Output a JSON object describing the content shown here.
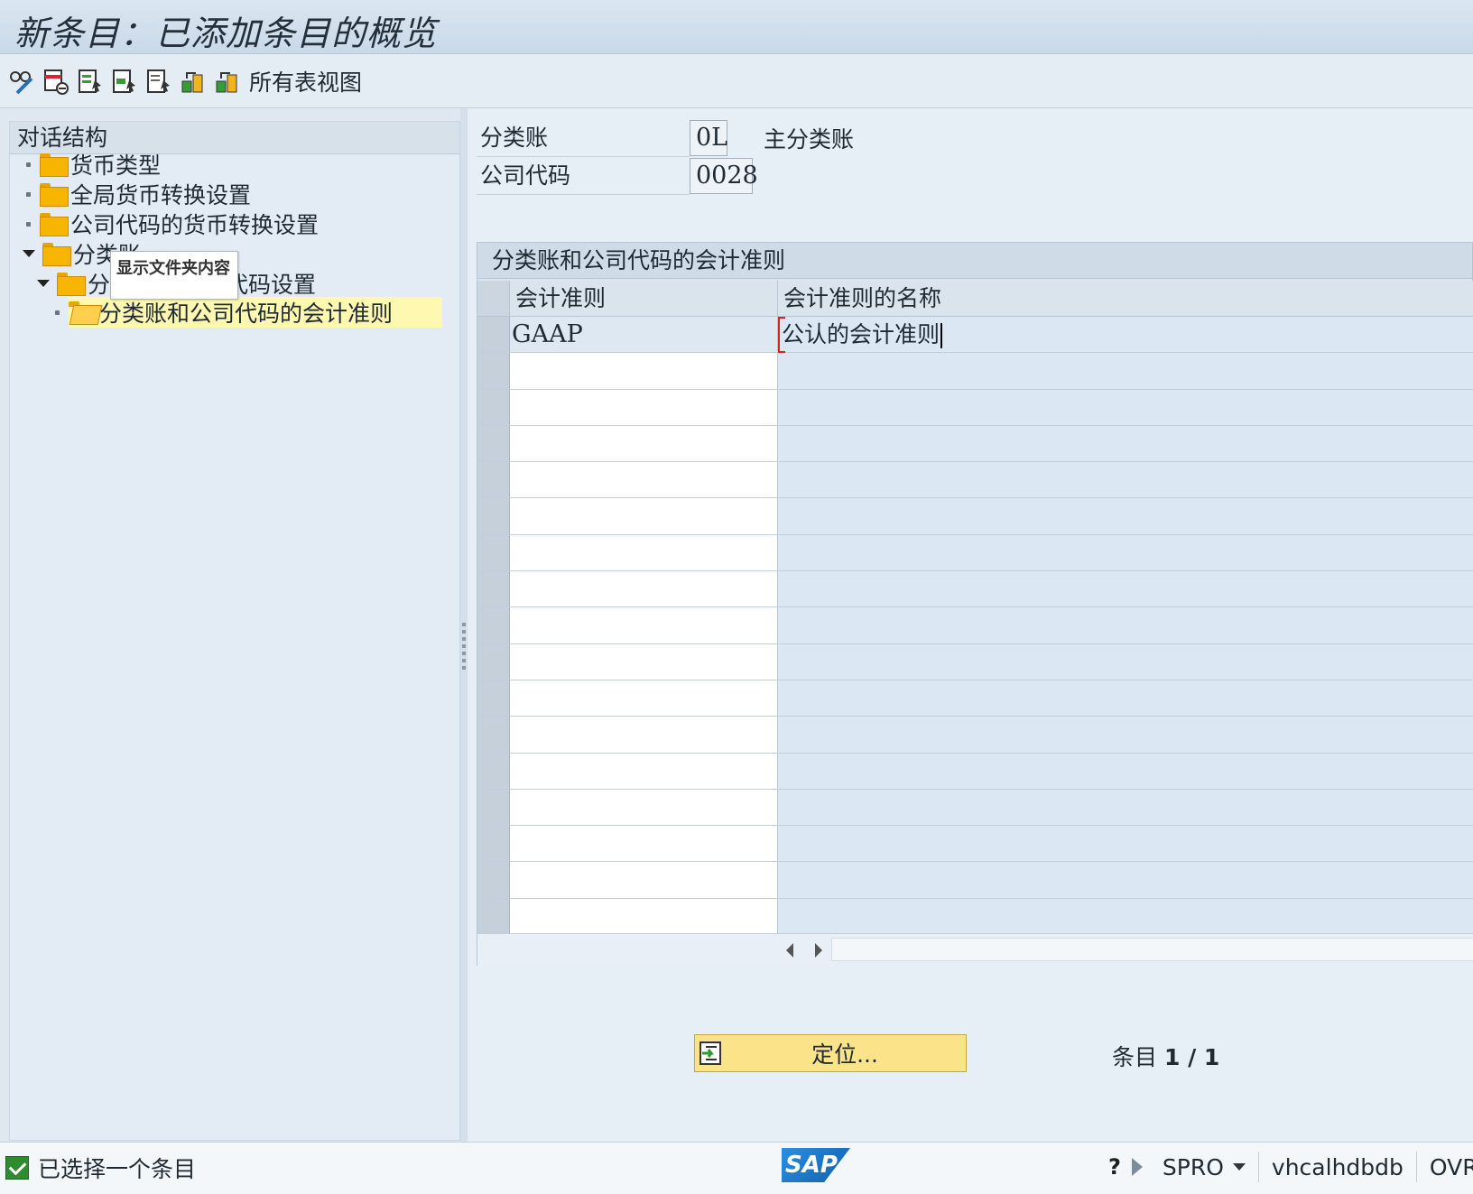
{
  "window": {
    "title": "新条目：已添加条目的概览"
  },
  "toolbar": {
    "icons": [
      "glasses-edit-icon",
      "delete-row-icon",
      "select-all-icon",
      "select-block-icon",
      "deselect-all-icon",
      "configure-icon",
      "all-table-views-icon"
    ],
    "all_views_label": "所有表视图"
  },
  "tree": {
    "header": "对话结构",
    "items": [
      {
        "label": "货币类型"
      },
      {
        "label": "全局货币转换设置"
      },
      {
        "label": "公司代码的货币转换设置"
      },
      {
        "label": "分类账"
      },
      {
        "label": "分类账和公司代码设置"
      },
      {
        "label": "分类账和公司代码的会计准则"
      }
    ],
    "tooltip": "显示文件夹内容",
    "partial": {
      "ledger": "分类账",
      "sub_prefix": "分",
      "sub_suffix": "代码设置"
    }
  },
  "fields": {
    "ledger_label": "分类账",
    "ledger_value": "0L",
    "ledger_desc": "主分类账",
    "company_label": "公司代码",
    "company_value": "0028"
  },
  "table": {
    "title": "分类账和公司代码的会计准则",
    "columns": [
      "会计准则",
      "会计准则的名称"
    ],
    "rows": [
      {
        "code": "GAAP",
        "name": "公认的会计准则"
      }
    ],
    "empty_rows": 16
  },
  "position_button": {
    "label": "定位..."
  },
  "entry_counter": {
    "label": "条目",
    "value": "1 / 1"
  },
  "statusbar": {
    "message": "已选择一个条目",
    "transaction": "SPRO",
    "system": "vhcalhdbdb",
    "mode": "OVR"
  },
  "colors": {
    "selected_tree_row": "#fff8b0",
    "position_button": "#fbe38a",
    "status_check": "#2e8b2e"
  }
}
